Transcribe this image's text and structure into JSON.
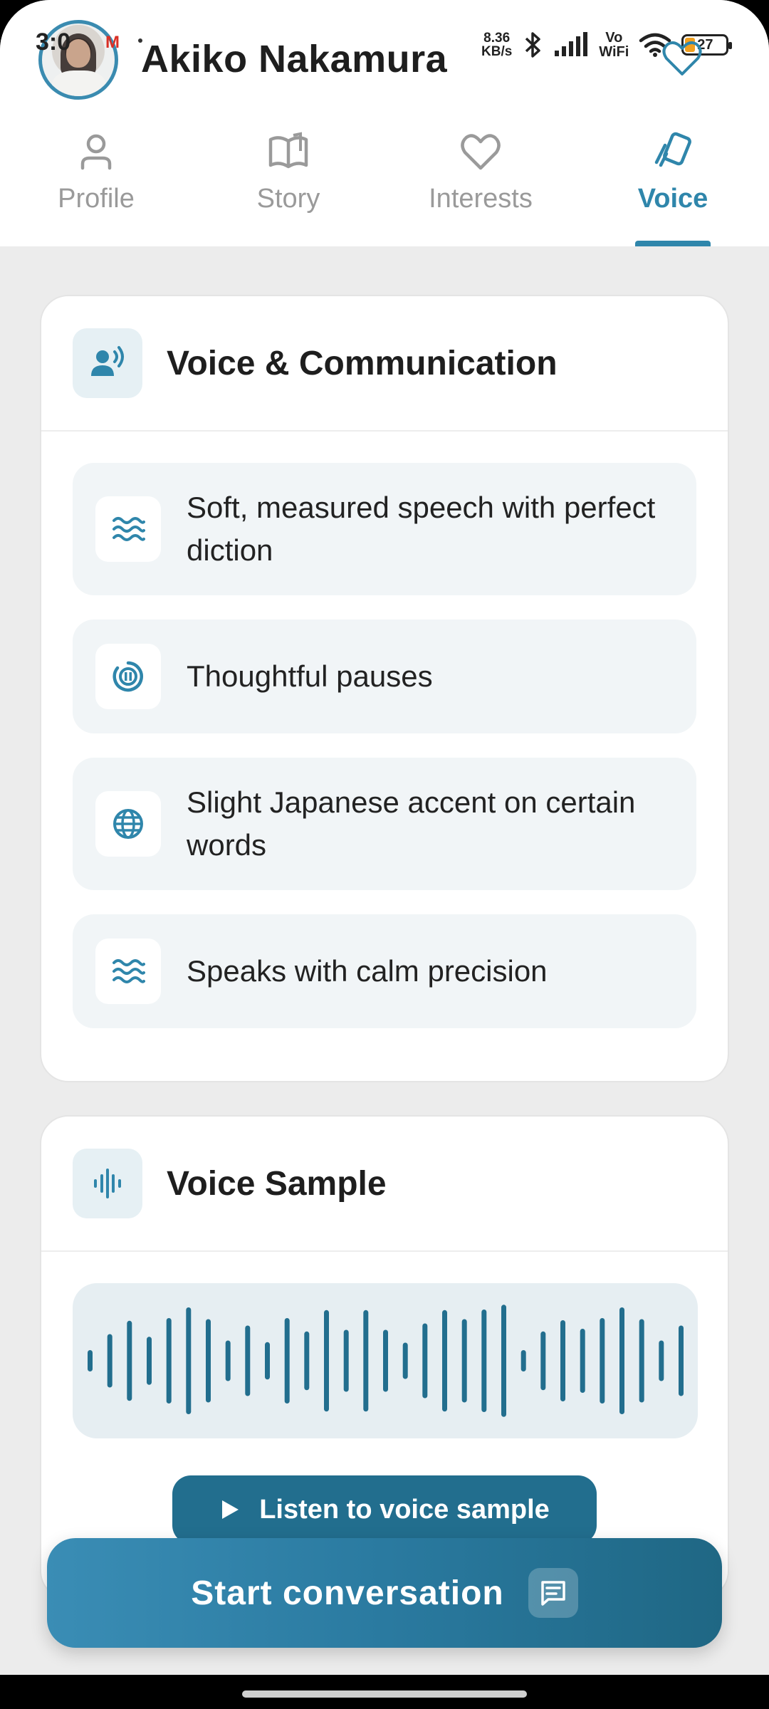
{
  "status_bar": {
    "time": "3:0",
    "gmail_icon": "M",
    "net_speed_value": "8.36",
    "net_speed_unit": "KB/s",
    "network_label_top": "Vo",
    "network_label_bottom": "WiFi",
    "battery_level": "27"
  },
  "header": {
    "user_name": "Akiko Nakamura",
    "avatar": "profile-photo",
    "favorite_icon": "heart-outline-icon"
  },
  "tabs": [
    {
      "label": "Profile",
      "icon": "person-icon",
      "active": false
    },
    {
      "label": "Story",
      "icon": "open-book-icon",
      "active": false
    },
    {
      "label": "Interests",
      "icon": "heart-icon",
      "active": false
    },
    {
      "label": "Voice",
      "icon": "cards-icon",
      "active": true
    }
  ],
  "voice_card": {
    "title": "Voice & Communication",
    "icon": "speaking-person-icon",
    "traits": [
      {
        "text": "Soft, measured speech with perfect diction",
        "icon": "waves-icon"
      },
      {
        "text": "Thoughtful pauses",
        "icon": "pause-circle-icon"
      },
      {
        "text": "Slight Japanese accent on certain words",
        "icon": "globe-icon"
      },
      {
        "text": "Speaks with calm precision",
        "icon": "waves-icon"
      }
    ]
  },
  "sample_card": {
    "title": "Voice Sample",
    "icon": "audio-bars-icon",
    "waveform_levels": [
      0.2,
      0.5,
      0.75,
      0.45,
      0.8,
      1.0,
      0.78,
      0.38,
      0.66,
      0.35,
      0.8,
      0.55,
      0.95,
      0.58,
      0.95,
      0.58,
      0.34,
      0.7,
      0.95,
      0.78,
      0.96,
      1.05,
      0.2,
      0.55,
      0.76,
      0.6,
      0.8,
      1.0,
      0.78,
      0.38,
      0.66
    ],
    "listen_label": "Listen to voice sample",
    "play_icon": "play-icon"
  },
  "cta": {
    "label": "Start conversation",
    "icon": "chat-message-icon"
  },
  "colors": {
    "accent": "#2f86ab",
    "accent_dark": "#226e8e",
    "card_tint": "#e6f0f4"
  }
}
